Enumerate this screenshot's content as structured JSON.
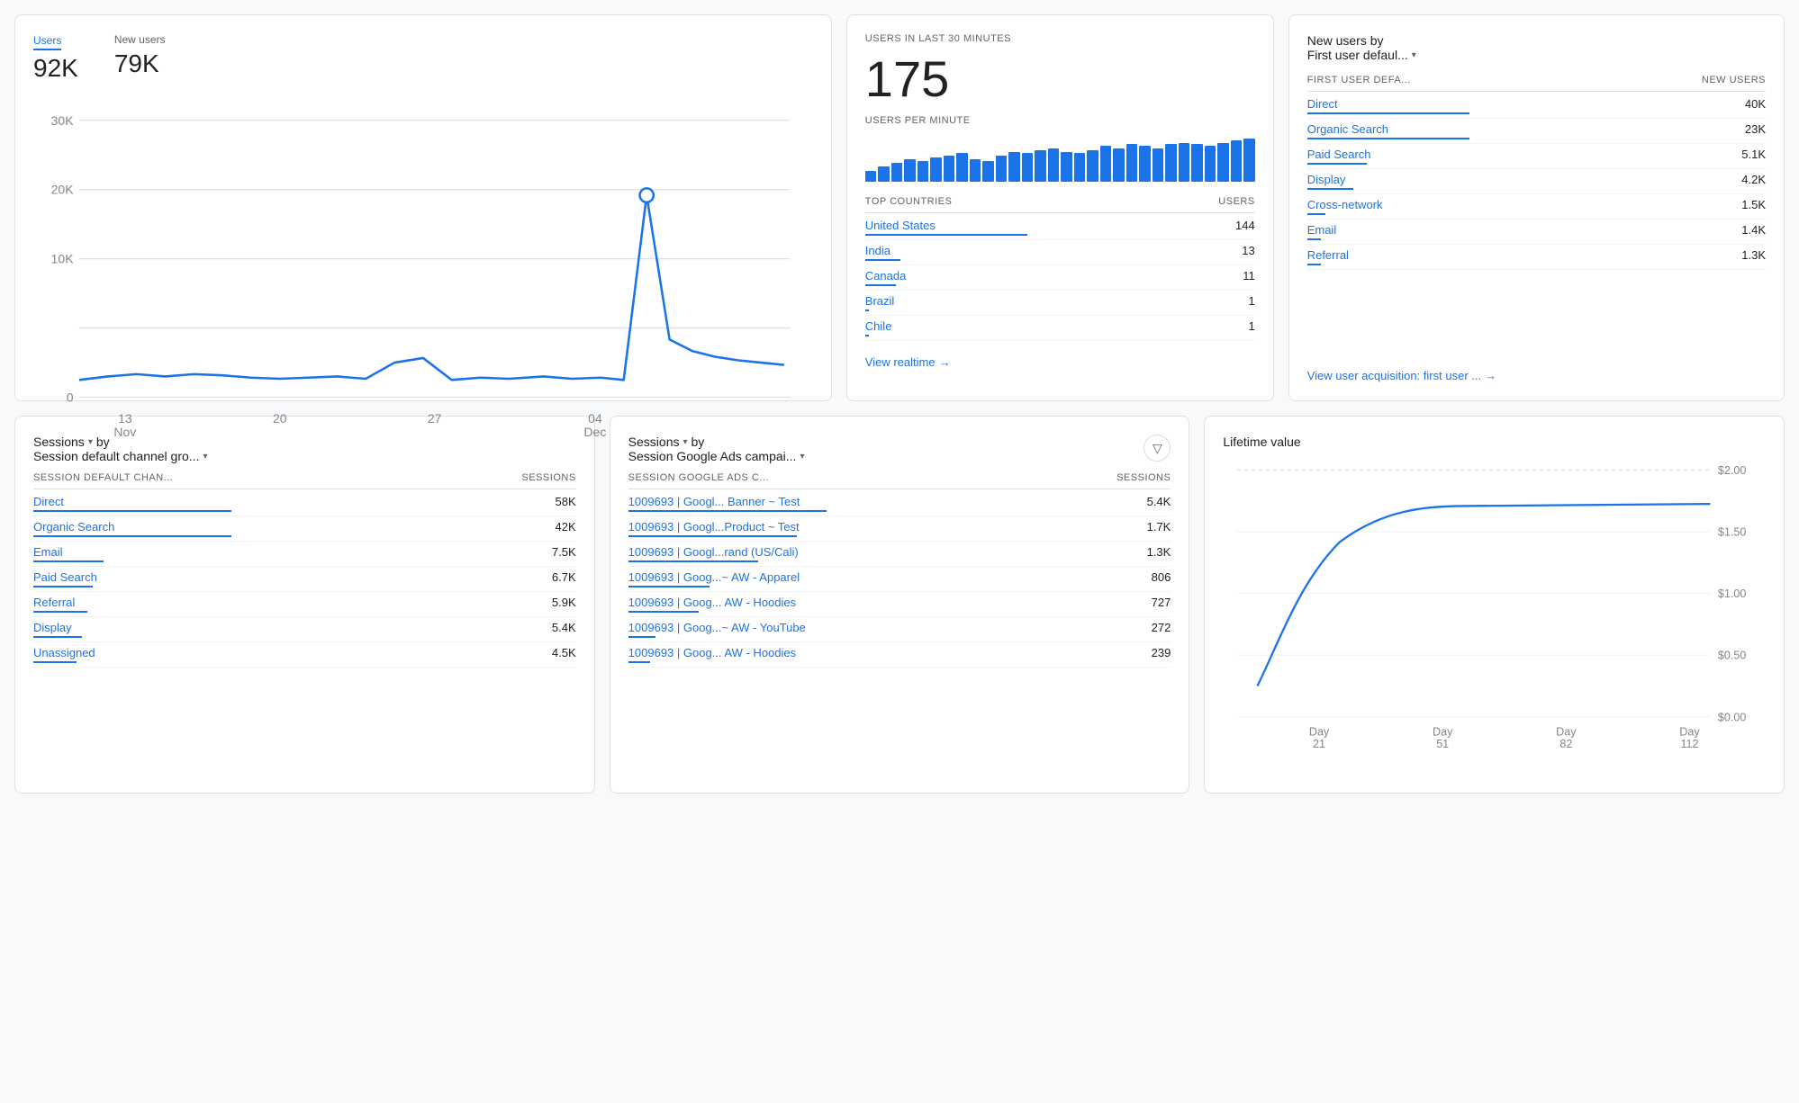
{
  "stats": {
    "users_label": "Users",
    "users_value": "92K",
    "new_users_label": "New users",
    "new_users_value": "79K"
  },
  "chart": {
    "x_labels": [
      "13\nNov",
      "20",
      "27",
      "04\nDec"
    ],
    "y_labels": [
      "30K",
      "20K",
      "10K",
      "0"
    ],
    "x_label_1": "13",
    "x_label_1b": "Nov",
    "x_label_2": "20",
    "x_label_3": "27",
    "x_label_4": "04",
    "x_label_4b": "Dec"
  },
  "realtime": {
    "title": "USERS IN LAST 30 MINUTES",
    "number": "175",
    "subtitle": "USERS PER MINUTE",
    "top_countries_header": "TOP COUNTRIES",
    "users_col": "USERS",
    "countries": [
      {
        "name": "United States",
        "value": "144",
        "bar_pct": 100
      },
      {
        "name": "India",
        "value": "13",
        "bar_pct": 9
      },
      {
        "name": "Canada",
        "value": "11",
        "bar_pct": 8
      },
      {
        "name": "Brazil",
        "value": "1",
        "bar_pct": 1
      },
      {
        "name": "Chile",
        "value": "1",
        "bar_pct": 1
      }
    ],
    "view_link": "View realtime",
    "mini_bars": [
      15,
      20,
      25,
      30,
      28,
      32,
      35,
      38,
      30,
      28,
      35,
      40,
      38,
      42,
      45,
      40,
      38,
      42,
      48,
      45,
      50,
      48,
      45,
      50,
      52,
      50,
      48,
      52,
      55,
      58
    ]
  },
  "acquisition": {
    "title": "New users by",
    "subtitle": "First user defaul...",
    "col1": "FIRST USER DEFA...",
    "col2": "NEW USERS",
    "channels": [
      {
        "name": "Direct",
        "value": "40K",
        "bar_pct": 100
      },
      {
        "name": "Organic Search",
        "value": "23K",
        "bar_pct": 57
      },
      {
        "name": "Paid Search",
        "value": "5.1K",
        "bar_pct": 13
      },
      {
        "name": "Display",
        "value": "4.2K",
        "bar_pct": 10
      },
      {
        "name": "Cross-network",
        "value": "1.5K",
        "bar_pct": 4
      },
      {
        "name": "Email",
        "value": "1.4K",
        "bar_pct": 3
      },
      {
        "name": "Referral",
        "value": "1.3K",
        "bar_pct": 3
      }
    ],
    "view_link": "View user acquisition: first user ..."
  },
  "sessions_channel": {
    "title": "Sessions",
    "by": "by",
    "subtitle": "Session default channel gro...",
    "col1": "SESSION DEFAULT CHAN...",
    "col2": "SESSIONS",
    "rows": [
      {
        "label": "Direct",
        "value": "58K",
        "bar_pct": 100
      },
      {
        "label": "Organic Search",
        "value": "42K",
        "bar_pct": 72
      },
      {
        "label": "Email",
        "value": "7.5K",
        "bar_pct": 13
      },
      {
        "label": "Paid Search",
        "value": "6.7K",
        "bar_pct": 11
      },
      {
        "label": "Referral",
        "value": "5.9K",
        "bar_pct": 10
      },
      {
        "label": "Display",
        "value": "5.4K",
        "bar_pct": 9
      },
      {
        "label": "Unassigned",
        "value": "4.5K",
        "bar_pct": 8
      }
    ]
  },
  "sessions_ads": {
    "title": "Sessions",
    "by": "by",
    "subtitle": "Session Google Ads campai...",
    "col1": "SESSION GOOGLE ADS C...",
    "col2": "SESSIONS",
    "filter_icon": "▽",
    "rows": [
      {
        "label": "1009693 | Googl... Banner ~ Test",
        "value": "5.4K",
        "bar_pct": 100
      },
      {
        "label": "1009693 | Googl...Product ~ Test",
        "value": "1.7K",
        "bar_pct": 31
      },
      {
        "label": "1009693 | Googl...rand (US/Cali)",
        "value": "1.3K",
        "bar_pct": 24
      },
      {
        "label": "1009693 | Goog...~ AW - Apparel",
        "value": "806",
        "bar_pct": 15
      },
      {
        "label": "1009693 | Goog... AW - Hoodies",
        "value": "727",
        "bar_pct": 13
      },
      {
        "label": "1009693 | Goog...~ AW - YouTube",
        "value": "272",
        "bar_pct": 5
      },
      {
        "label": "1009693 | Goog... AW - Hoodies",
        "value": "239",
        "bar_pct": 4
      }
    ]
  },
  "lifetime": {
    "title": "Lifetime value",
    "y_labels": [
      "$2.00",
      "$1.50",
      "$1.00",
      "$0.50",
      "$0.00"
    ],
    "x_labels": [
      "Day\n21",
      "Day\n51",
      "Day\n82",
      "Day\n112"
    ],
    "x_label_1": "Day",
    "x_label_1b": "21",
    "x_label_2": "Day",
    "x_label_2b": "51",
    "x_label_3": "Day",
    "x_label_3b": "82",
    "x_label_4": "Day",
    "x_label_4b": "112"
  }
}
